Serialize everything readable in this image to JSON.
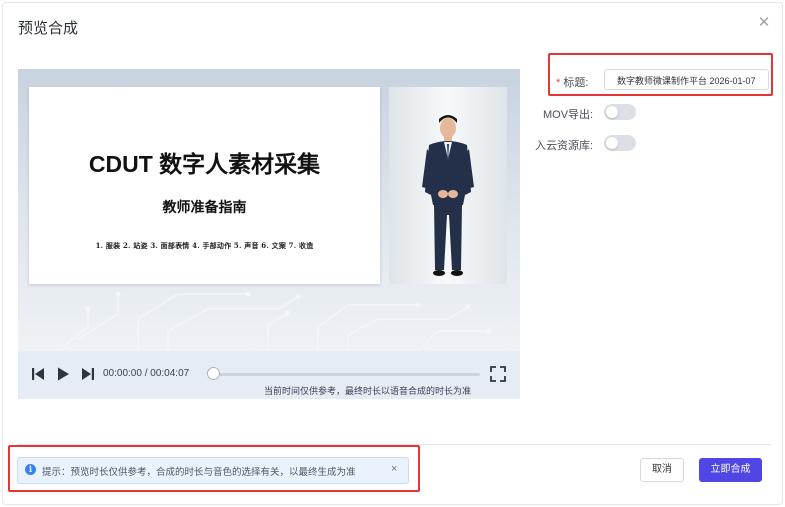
{
  "dialog": {
    "title": "预览合成",
    "close_icon": "close-icon"
  },
  "slide": {
    "main_title": "CDUT 数字人素材采集",
    "subtitle": "教师准备指南",
    "items": "1. 服装   2. 站姿   3. 面部表情   4. 手部动作   5. 声音   6. 文案   7. 收造"
  },
  "player": {
    "time": "00:00:00 / 00:04:07",
    "progress": 0,
    "note": "当前时间仅供参考，最终时长以语音合成的时长为准",
    "icons": [
      "skip-back-icon",
      "play-icon",
      "skip-forward-icon",
      "fullscreen-icon"
    ]
  },
  "form": {
    "title_required_mark": "*",
    "title_label": "标题:",
    "title_value": "数字教师微课制作平台 2026-01-07",
    "mov_label": "MOV导出:",
    "mov_on": false,
    "cloud_label": "入云资源库:",
    "cloud_on": false
  },
  "tip": {
    "icon": "info-icon",
    "text": "提示：预览时长仅供参考，合成的时长与音色的选择有关，以最终生成为准",
    "close": "×"
  },
  "footer": {
    "cancel_label": "取消",
    "submit_label": "立即合成"
  },
  "colors": {
    "primary": "#4f46e5",
    "highlight": "#e53535",
    "tip_bg": "#eaf3fd",
    "info": "#3a82f0"
  }
}
